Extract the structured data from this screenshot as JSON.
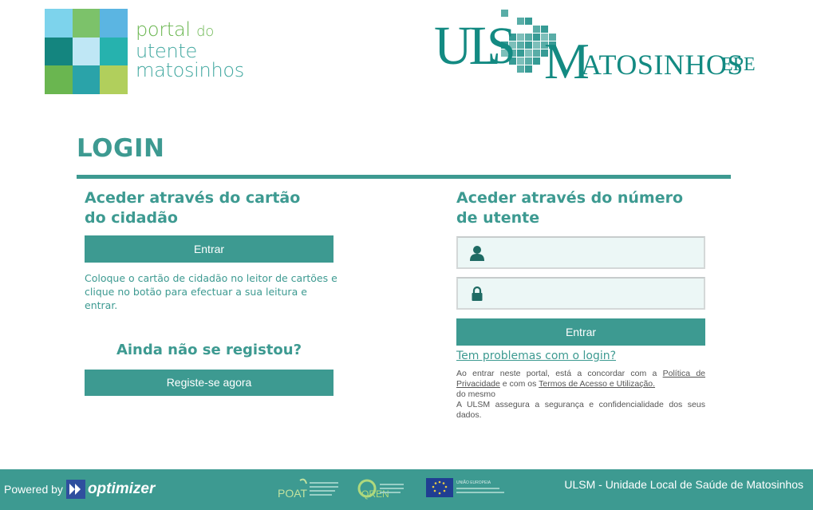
{
  "header": {
    "portal_logo": {
      "line1": "portal",
      "line1_small": "do",
      "line2": "utente",
      "line3": "matosinhos",
      "mosaic_colors": [
        "#7dd3ec",
        "#7cc26a",
        "#5bb5e2",
        "#14857f",
        "#bfe7f5",
        "#26b2ae",
        "#6ab650",
        "#2aa3a9",
        "#b1cf5c"
      ]
    },
    "ulsm_logo": {
      "u": "UL",
      "s": "S",
      "m": "M",
      "rest": "ATOSINHOS",
      "epe": "EPE",
      "color": "#138a82"
    }
  },
  "login": {
    "title": "LOGIN",
    "card_section": {
      "heading": "Aceder através do cartão do cidadão",
      "button": "Entrar",
      "help": "Coloque o cartão de cidadão no leitor de cartões e clique no botão para efectuar a sua leitura e entrar."
    },
    "register": {
      "question": "Ainda não se registou?",
      "button": "Registe-se agora"
    },
    "number_section": {
      "heading": "Aceder através do número de utente",
      "username_value": "",
      "password_value": "",
      "button": "Entrar",
      "help_link": "Tem problemas com o login?",
      "terms_prefix": "Ao entrar neste portal, está a concordar com a",
      "privacy_link": "Política de Privacidade",
      "terms_mid": "e com os",
      "terms_link": "Termos de Acesso e Utilização.",
      "terms_suffix": "do mesmo",
      "security_note": "A ULSM assegura a segurança e confidencialidade dos seus dados."
    }
  },
  "footer": {
    "powered_by": "Powered by",
    "brand": "optimizer",
    "sponsors": [
      "POAT",
      "QREN",
      "UNIÃO EUROPEIA"
    ],
    "right_text": "ULSM - Unidade Local de Saúde de Matosinhos"
  },
  "colors": {
    "accent": "#3d9a91",
    "footer_bg": "#3d9a91",
    "field_bg": "#ecf7f6"
  }
}
